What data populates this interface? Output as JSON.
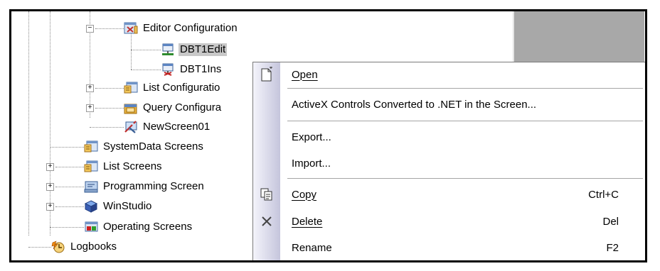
{
  "tree": {
    "items": [
      {
        "label": "Editor Configuration",
        "icon": "editor-configuration-icon"
      },
      {
        "label": "DBT1Edit",
        "icon": "database-table-edit-icon",
        "selected": true
      },
      {
        "label": "DBT1Ins",
        "icon": "database-table-insert-icon"
      },
      {
        "label": "List Configuratio",
        "icon": "list-configuration-icon"
      },
      {
        "label": "Query Configura",
        "icon": "query-configuration-icon"
      },
      {
        "label": "NewScreen01",
        "icon": "new-screen-icon"
      },
      {
        "label": "SystemData Screens",
        "icon": "screen-folder-icon"
      },
      {
        "label": "List Screens",
        "icon": "screen-folder-icon"
      },
      {
        "label": "Programming Screen",
        "icon": "programming-screen-icon"
      },
      {
        "label": "WinStudio",
        "icon": "winstudio-cube-icon"
      },
      {
        "label": "Operating Screens",
        "icon": "operating-screen-icon"
      },
      {
        "label": "Logbooks",
        "icon": "logbooks-icon"
      }
    ],
    "expander_expanded": "−",
    "expander_collapsed": "+"
  },
  "context_menu": {
    "open": {
      "label": "Open",
      "accel": "O",
      "icon": "open-document-icon"
    },
    "activex": {
      "label": "ActiveX Controls Converted to .NET in the Screen..."
    },
    "export": {
      "label": "Export..."
    },
    "import": {
      "label": "Import..."
    },
    "copy": {
      "label": "Copy",
      "shortcut": "Ctrl+C",
      "icon": "copy-icon"
    },
    "delete": {
      "label": "Delete",
      "shortcut": "Del",
      "icon": "delete-x-icon"
    },
    "rename": {
      "label": "Rename",
      "shortcut": "F2"
    }
  },
  "colors": {
    "selection": "#c8c8c8",
    "side_pane": "#a8a8a8",
    "menu_strip": "#c5c5dc"
  }
}
